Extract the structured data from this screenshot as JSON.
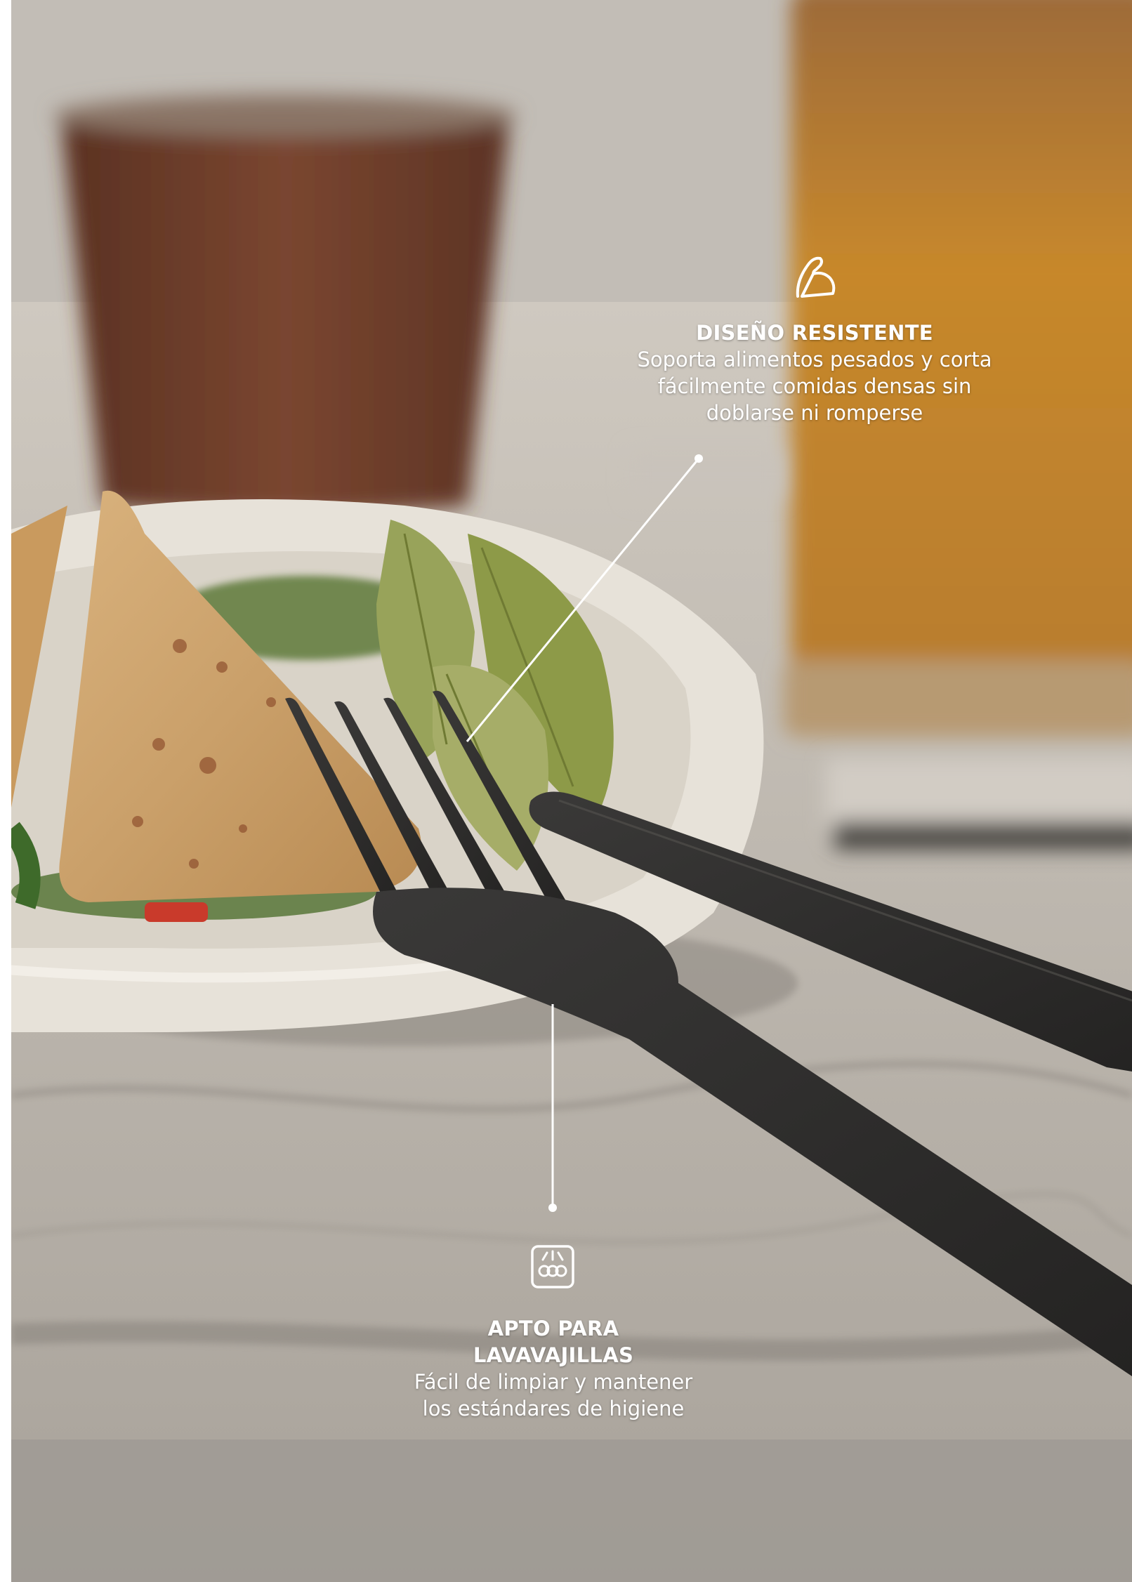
{
  "colors": {
    "annotation_text": "#ffffff",
    "fork_black": "#2b2a29",
    "plate_white": "#e8e4dc",
    "leaf_green": "#8d9a48",
    "glass_amber": "#c8892c",
    "cup_brown": "#6e3c28"
  },
  "features": [
    {
      "icon": "flexed-arm-icon",
      "title": "DISEÑO RESISTENTE",
      "description_lines": [
        "Soporta alimentos pesados y corta",
        "fácilmente comidas densas sin",
        "doblarse ni romperse"
      ]
    },
    {
      "icon": "dishwasher-icon",
      "title_lines": [
        "APTO PARA",
        "LAVAVAJILLAS"
      ],
      "description_lines": [
        "Fácil de limpiar y mantener",
        "los estándares de higiene"
      ]
    }
  ]
}
